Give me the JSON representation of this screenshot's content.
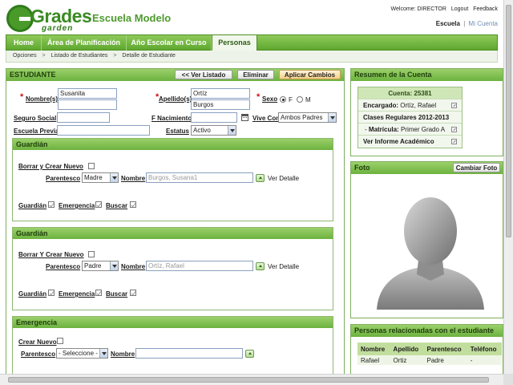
{
  "header": {
    "logo_word": "Grades",
    "logo_sub": "garden",
    "school": "Escuela Modelo",
    "welcome": "Welcome: DIRECTOR",
    "logout": "Logout",
    "feedback": "Feedback",
    "scope_active": "Escuela",
    "scope_sep": "|",
    "scope_other": "Mi Cuenta"
  },
  "nav": {
    "tabs": [
      "Home",
      "Área de Planificación",
      "Año Escolar en Curso",
      "Personas"
    ],
    "active": "Personas"
  },
  "breadcrumb": [
    "Opciones",
    ">",
    "Listado de Estudiantes",
    ">",
    "Detalle de Estudiante"
  ],
  "student": {
    "title": "ESTUDIANTE",
    "btn_list": "<< Ver Listado",
    "btn_delete": "Eliminar",
    "btn_apply": "Aplicar Cambios",
    "label_names": "Nombre(s)",
    "name1": "Susanita",
    "name2": "",
    "label_lastnames": "Apellido(s)",
    "lastname1": "Ortíz",
    "lastname2": "Burgos",
    "label_sex": "Sexo",
    "sex_f": "F",
    "sex_m": "M",
    "label_ssn": "Seguro Social",
    "ssn": "",
    "label_birth": "F Nacimiento",
    "birth": "",
    "label_lives": "Vive Con",
    "lives_with": "Ambos Padres",
    "label_prev_school": "Escuela Previa",
    "prev_school": "",
    "label_status": "Estatus",
    "status": "Activo"
  },
  "guardian1": {
    "title": "Guardián",
    "clear_label": "Borrar y Crear Nuevo",
    "relation_label": "Parentesco",
    "relation": "Madre",
    "name_label": "Nombre",
    "name": "Burgos, Susana1",
    "details": "Ver Detalle",
    "flag_guardian": "Guardián",
    "flag_emergency": "Emergencia",
    "flag_pickup": "Buscar"
  },
  "guardian2": {
    "title": "Guardián",
    "clear_label": "Borrar Y Crear Nuevo",
    "relation_label": "Parentesco",
    "relation": "Padre",
    "name_label": "Nombre",
    "name": "Ortíz, Rafael",
    "details": "Ver Detalle",
    "flag_guardian": "Guardián",
    "flag_emergency": "Emergencia",
    "flag_pickup": "Buscar"
  },
  "emergency": {
    "title": "Emergencia",
    "create_label": "Crear Nuevo",
    "relation_label": "Parentesco",
    "relation": "- Seleccione -",
    "name_label": "Nombre",
    "name": ""
  },
  "account": {
    "title": "Resumen de la Cuenta",
    "account_line": "Cuenta: 25381",
    "manager_label": "Encargado:",
    "manager": "Ortíz, Rafael",
    "classes": "Clases Regulares 2012-2013",
    "bullet": "-",
    "enroll_label": "Matrícula:",
    "enroll": "Primer Grado A",
    "report": "Ver Informe Académico"
  },
  "photo": {
    "title": "Foto",
    "change": "Cambiar Foto"
  },
  "related": {
    "title": "Personas relacionadas con el estudiante",
    "columns": [
      "Nombre",
      "Apellido",
      "Parentesco",
      "Teléfono"
    ],
    "rows": [
      [
        "Rafael",
        "Ortiz",
        "Padre",
        "-"
      ]
    ]
  },
  "colors": {
    "brand_green": "#5ea72f",
    "header_text": "#4e9a2e",
    "required": "#cc1111"
  }
}
